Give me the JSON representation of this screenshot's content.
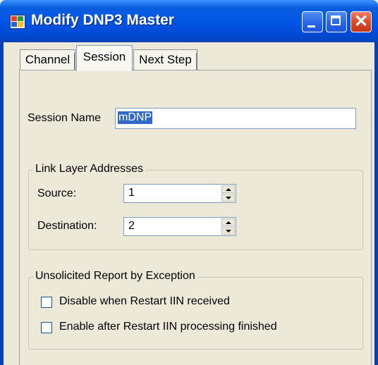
{
  "window": {
    "title": "Modify DNP3 Master"
  },
  "tabs": [
    {
      "label": "Channel",
      "selected": false
    },
    {
      "label": "Session",
      "selected": true
    },
    {
      "label": "Next Step",
      "selected": false
    }
  ],
  "session": {
    "name_label": "Session Name",
    "name_value": "mDNP"
  },
  "link_layer": {
    "legend": "Link Layer Addresses",
    "source_label": "Source:",
    "source_value": "1",
    "destination_label": "Destination:",
    "destination_value": "2"
  },
  "unsolicited": {
    "legend": "Unsolicited Report by Exception",
    "options": [
      {
        "label": "Disable when Restart IIN received",
        "checked": false
      },
      {
        "label": "Enable after Restart IIN processing finished",
        "checked": false
      }
    ]
  },
  "icons": {
    "app": "app-window-icon",
    "minimize": "minimize-icon",
    "maximize": "maximize-icon",
    "close": "close-icon",
    "spin_up": "arrow-up-icon",
    "spin_down": "arrow-down-icon"
  },
  "colors": {
    "titlebar": "#0054e3",
    "selection": "#316ac5",
    "dialog_bg": "#ece9d8",
    "close_button": "#d9472b"
  }
}
